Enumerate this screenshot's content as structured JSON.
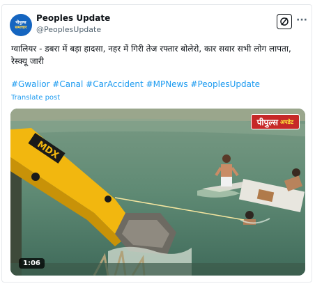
{
  "account": {
    "avatar_top": "पीपुल्स",
    "avatar_bottom": "समाचार",
    "name": "Peoples Update",
    "handle": "@PeoplesUpdate"
  },
  "post": {
    "text": "ग्वालियर - डबरा में बड़ा हादसा, नहर में गिरी तेज रफ्तार बोलेरो, कार सवार सभी लोग लापता, रेस्क्यू जारी",
    "hashtags": "#Gwalior #Canal #CarAccident #MPNews #PeoplesUpdate",
    "translate_label": "Translate post"
  },
  "media": {
    "logo_main": "पीपुल्स",
    "logo_sub": "अपडेट",
    "excavator_brand": "MDX",
    "duration": "1:06"
  },
  "colors": {
    "link": "#1d9bf0",
    "brand_red": "#c62828",
    "excavator_yellow": "#f2b70f"
  },
  "icons": {
    "grok": "grok-icon",
    "more": "more-icon"
  }
}
